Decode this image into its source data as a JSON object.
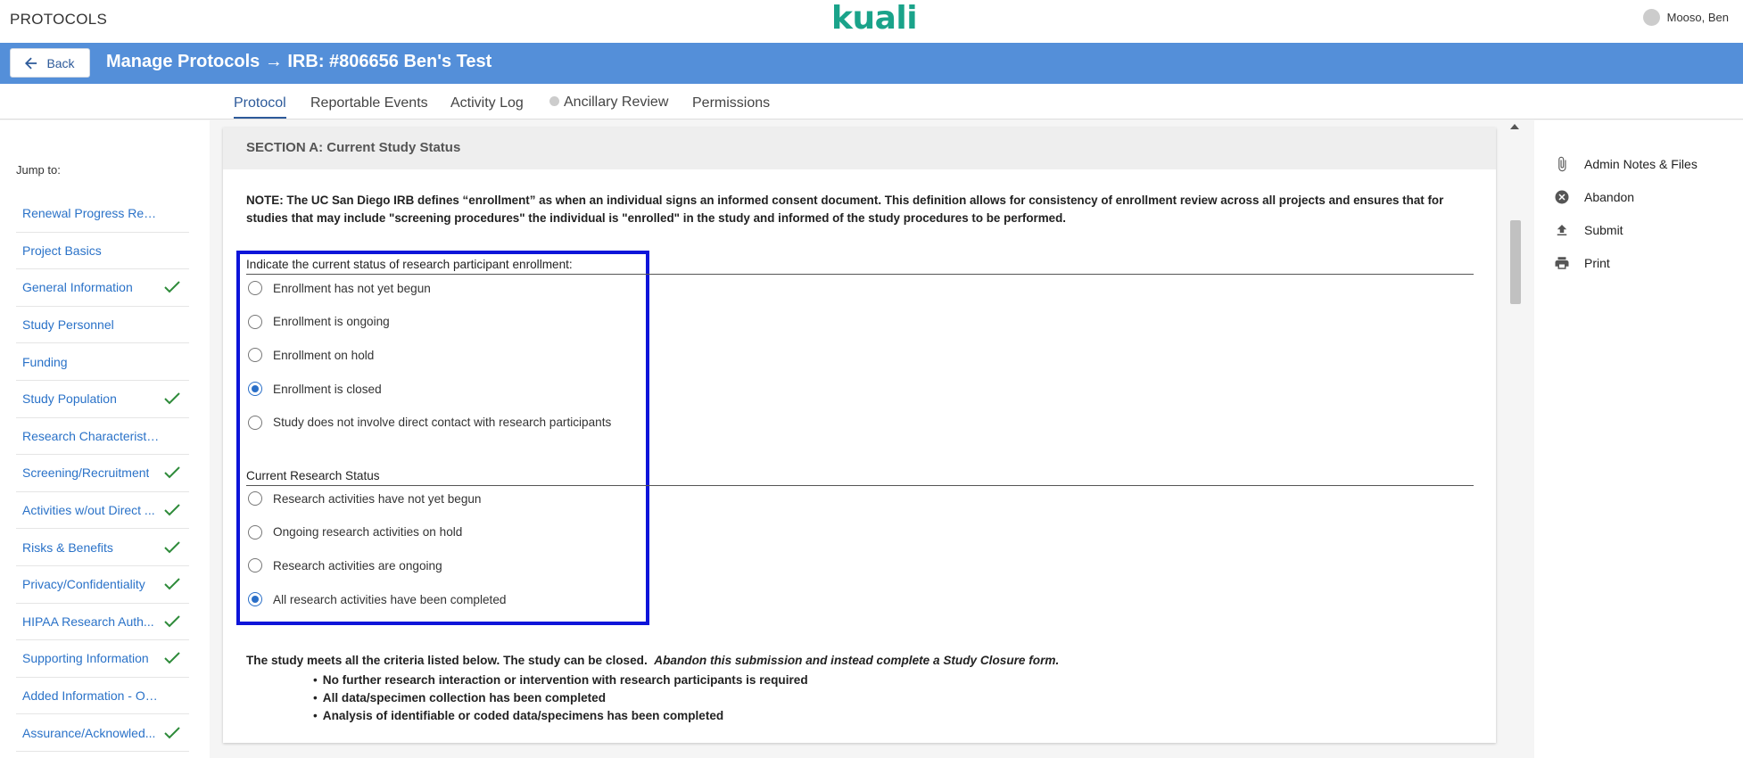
{
  "app": {
    "name": "PROTOCOLS",
    "logo": "kuali",
    "user": "Mooso, Ben"
  },
  "header": {
    "back_label": "Back",
    "title": "Manage Protocols → IRB: #806656 Ben's Test"
  },
  "tabs": [
    {
      "label": "Protocol",
      "active": true
    },
    {
      "label": "Reportable Events"
    },
    {
      "label": "Activity Log"
    },
    {
      "label": "Ancillary Review"
    },
    {
      "label": "Permissions"
    }
  ],
  "sidebar": {
    "jump_to": "Jump to:",
    "items": [
      {
        "label": "Renewal Progress Report",
        "complete": false
      },
      {
        "label": "Project Basics",
        "complete": false
      },
      {
        "label": "General Information",
        "complete": true
      },
      {
        "label": "Study Personnel",
        "complete": false
      },
      {
        "label": "Funding",
        "complete": false
      },
      {
        "label": "Study Population",
        "complete": true
      },
      {
        "label": "Research Characteristics",
        "complete": false
      },
      {
        "label": "Screening/Recruitment",
        "complete": true
      },
      {
        "label": "Activities w/out Direct ...",
        "complete": true
      },
      {
        "label": "Risks & Benefits",
        "complete": true
      },
      {
        "label": "Privacy/Confidentiality",
        "complete": true
      },
      {
        "label": "HIPAA Research Auth...",
        "complete": true
      },
      {
        "label": "Supporting Information",
        "complete": true
      },
      {
        "label": "Added Information - Optio...",
        "complete": false
      },
      {
        "label": "Assurance/Acknowled...",
        "complete": true
      }
    ]
  },
  "section": {
    "title": "SECTION A: Current Study Status",
    "note_prefix": "NOTE: ",
    "note": "The UC San Diego IRB defines “enrollment” as when an individual signs an informed consent document. This definition allows for consistency of enrollment review across all projects and ensures that for studies that may include \"screening procedures\" the individual is \"enrolled\" in the study and informed of the study procedures to be performed.",
    "enrollment": {
      "label": "Indicate the current status of research participant enrollment:",
      "options": [
        {
          "label": "Enrollment has not yet begun",
          "selected": false
        },
        {
          "label": "Enrollment is ongoing",
          "selected": false
        },
        {
          "label": "Enrollment on hold",
          "selected": false
        },
        {
          "label": "Enrollment is closed",
          "selected": true
        },
        {
          "label": "Study does not involve direct contact with research participants",
          "selected": false
        }
      ]
    },
    "research_status": {
      "label": "Current Research Status",
      "options": [
        {
          "label": "Research activities have not yet begun",
          "selected": false
        },
        {
          "label": "Ongoing research activities on hold",
          "selected": false
        },
        {
          "label": "Research activities are ongoing",
          "selected": false
        },
        {
          "label": "All research activities have been completed",
          "selected": true
        }
      ]
    },
    "closure_text": "The study meets all the criteria listed below.  The study can be closed.",
    "closure_italic": "Abandon this submission and instead complete a Study Closure form.",
    "criteria": [
      "No further research interaction or intervention with research participants is required",
      "All data/specimen collection has been completed",
      "Analysis of identifiable or coded data/specimens has been completed"
    ]
  },
  "actions": [
    {
      "label": "Admin Notes & Files",
      "icon": "paperclip-icon"
    },
    {
      "label": "Abandon",
      "icon": "close-circle-icon"
    },
    {
      "label": "Submit",
      "icon": "upload-icon"
    },
    {
      "label": "Print",
      "icon": "printer-icon"
    }
  ],
  "colors": {
    "header": "#548fd9",
    "brand": "#1aa38a",
    "link": "#2a72c8",
    "highlight": "#0d14d9",
    "check": "#2e8b3a"
  }
}
